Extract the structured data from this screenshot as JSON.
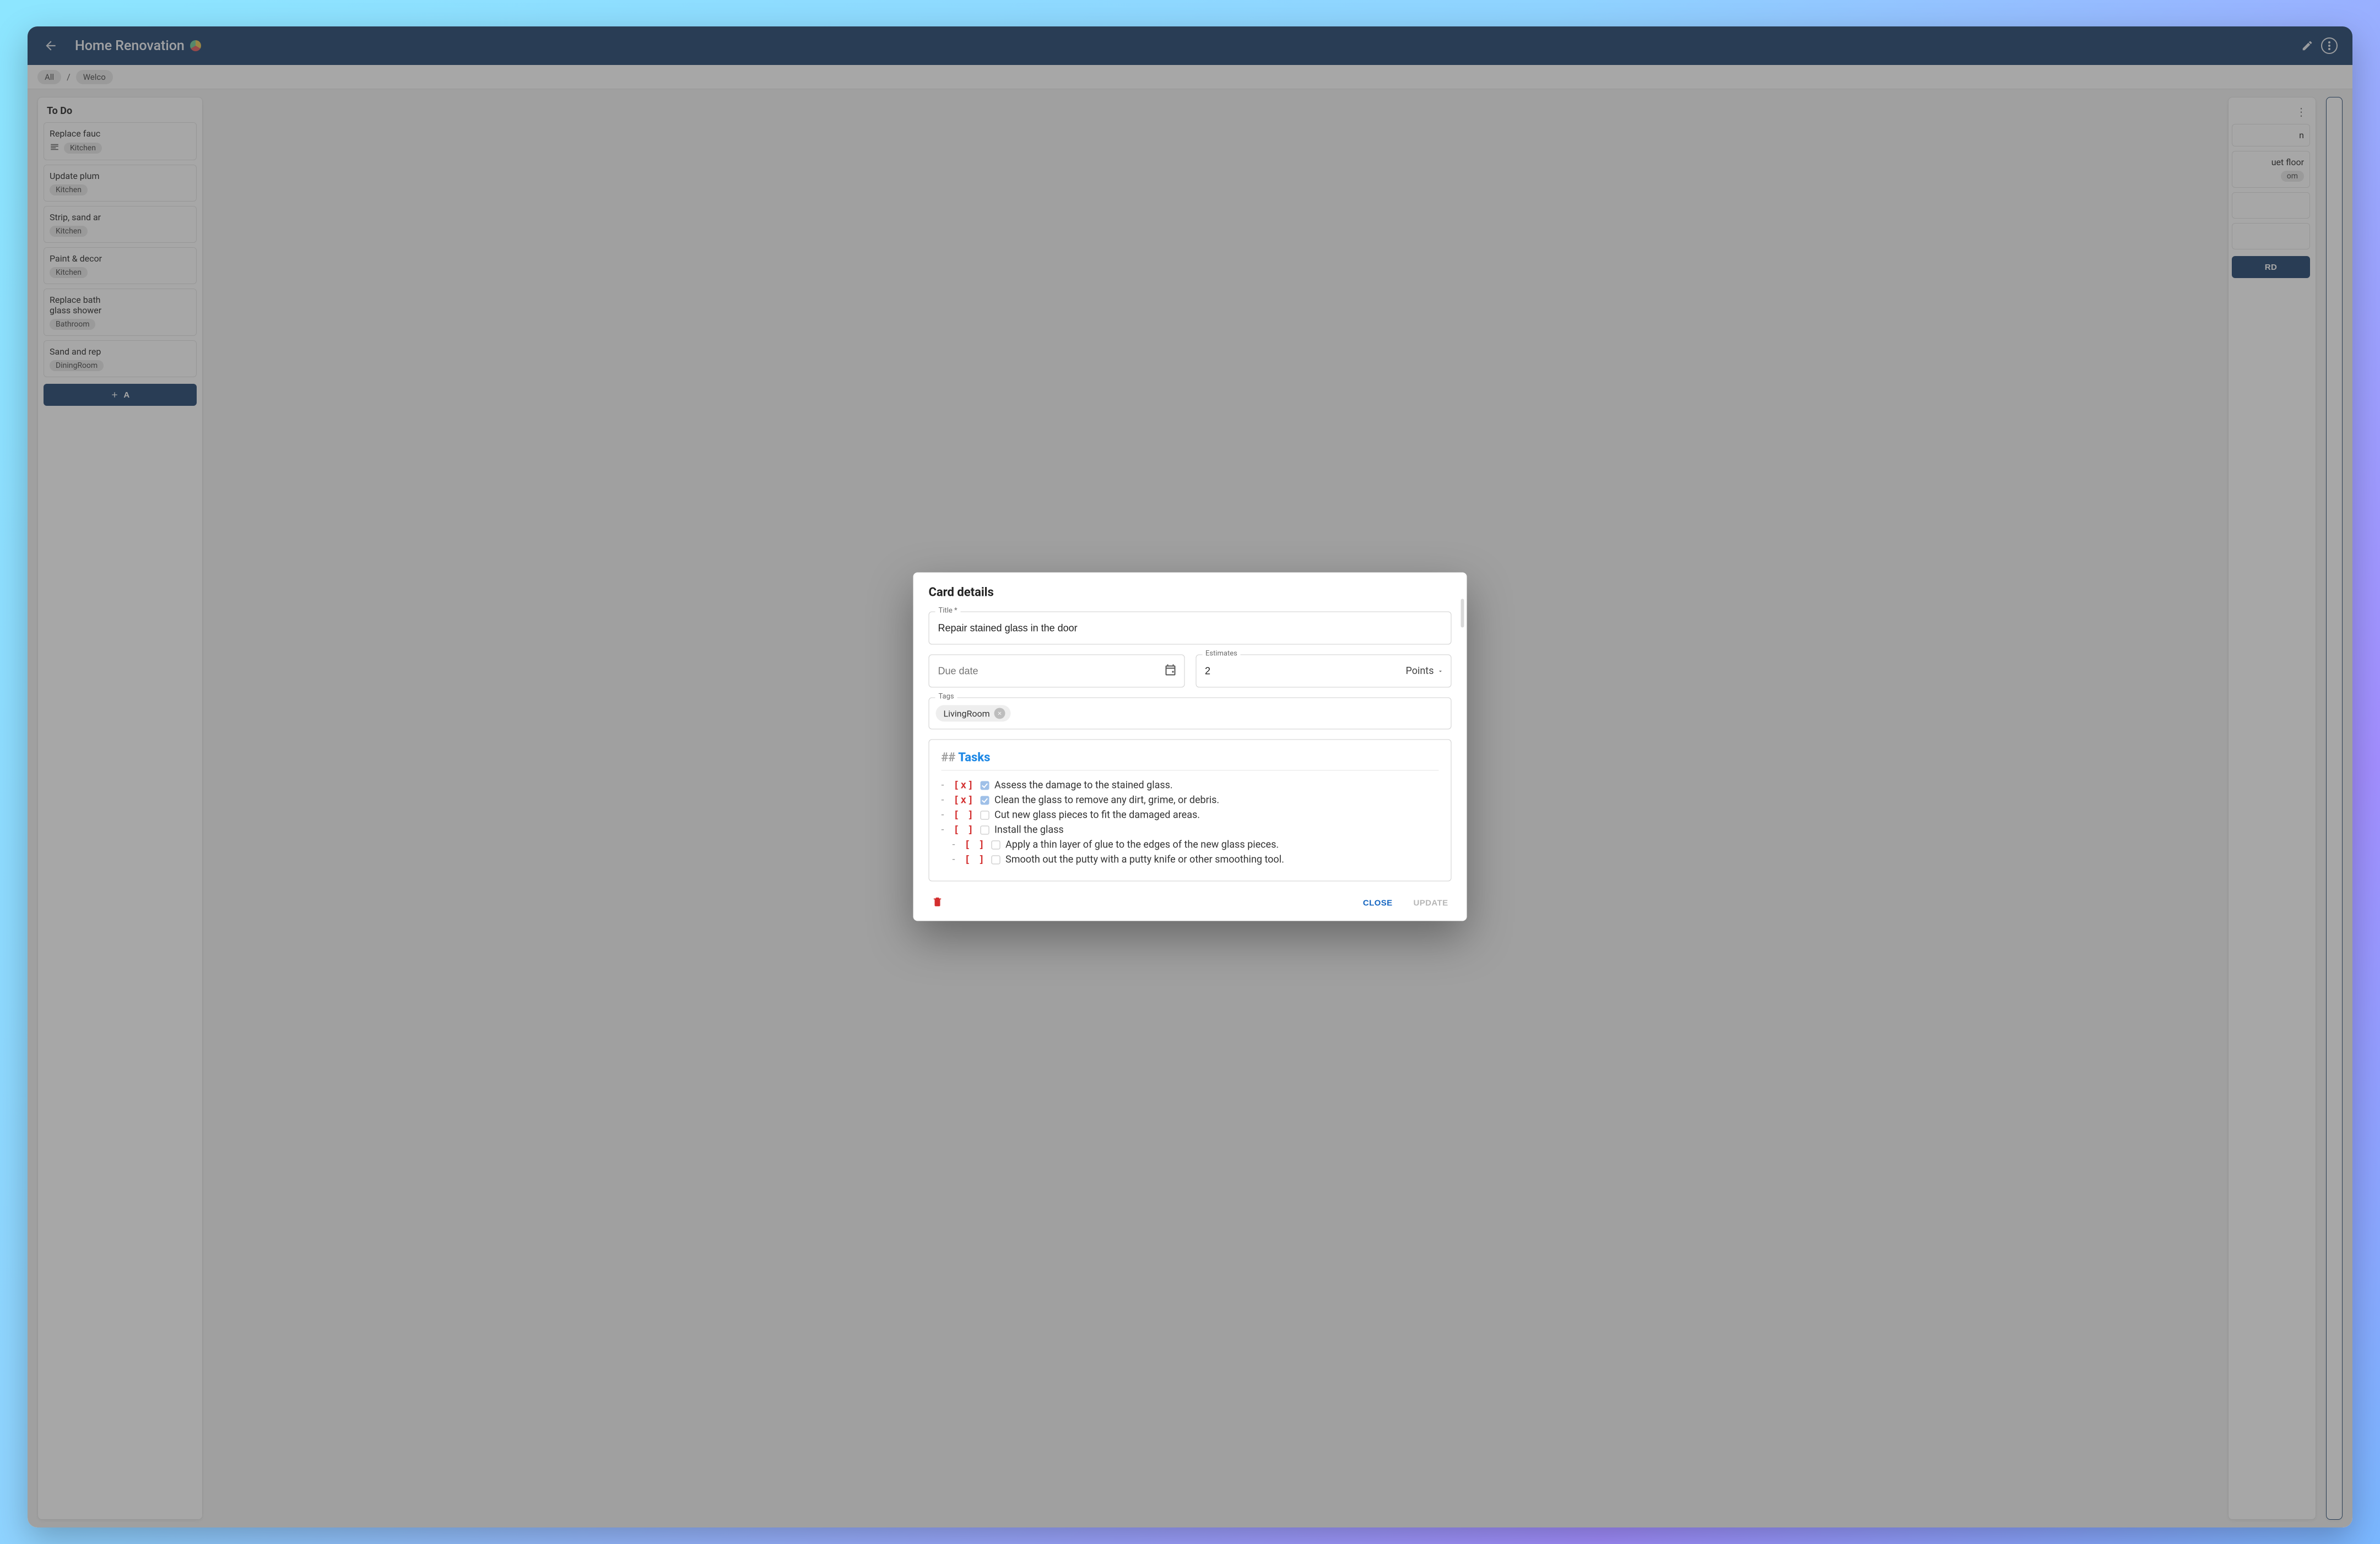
{
  "topbar": {
    "board_title": "Home Renovation",
    "back_aria": "Back"
  },
  "breadcrumb": {
    "all": "All",
    "current": "Welco"
  },
  "board": {
    "todo_title": "To Do",
    "add_card_label": "A",
    "right_add_card_label": "RD",
    "cards": [
      {
        "title": "Replace fauc",
        "tag": "Kitchen",
        "has_desc": true
      },
      {
        "title": "Update plum",
        "tag": "Kitchen",
        "has_desc": false
      },
      {
        "title": "Strip, sand ar",
        "tag": "Kitchen",
        "has_desc": false
      },
      {
        "title": "Paint & decor",
        "tag": "Kitchen",
        "has_desc": false
      },
      {
        "title": "Replace bath\nglass shower",
        "tag": "Bathroom",
        "has_desc": false
      },
      {
        "title": "Sand and rep",
        "tag": "DiningRoom",
        "has_desc": false
      }
    ],
    "right_cards": [
      {
        "title": "n",
        "tag": ""
      },
      {
        "title": "uet floor",
        "tag": "om"
      }
    ]
  },
  "dialog": {
    "heading": "Card details",
    "title_label": "Title *",
    "title_value": "Repair stained glass in the door",
    "due_label": "Due date",
    "due_value": "",
    "estimates_label": "Estimates",
    "estimates_value": "2",
    "estimates_unit": "Points",
    "tags_label": "Tags",
    "tag_chip": "LivingRoom",
    "editor_heading_hash": "##",
    "editor_heading_title": "Tasks",
    "tasks": [
      {
        "done": true,
        "indent": 0,
        "text": "Assess the damage to the stained glass."
      },
      {
        "done": true,
        "indent": 0,
        "text": "Clean the glass to remove any dirt, grime, or debris."
      },
      {
        "done": false,
        "indent": 0,
        "text": "Cut new glass pieces to fit the damaged areas."
      },
      {
        "done": false,
        "indent": 0,
        "text": "Install the glass"
      },
      {
        "done": false,
        "indent": 1,
        "text": "Apply a thin layer of glue to the edges of the new glass pieces."
      },
      {
        "done": false,
        "indent": 1,
        "text": "Smooth out the putty with a putty knife or other smoothing tool."
      }
    ],
    "close_label": "CLOSE",
    "update_label": "UPDATE"
  }
}
